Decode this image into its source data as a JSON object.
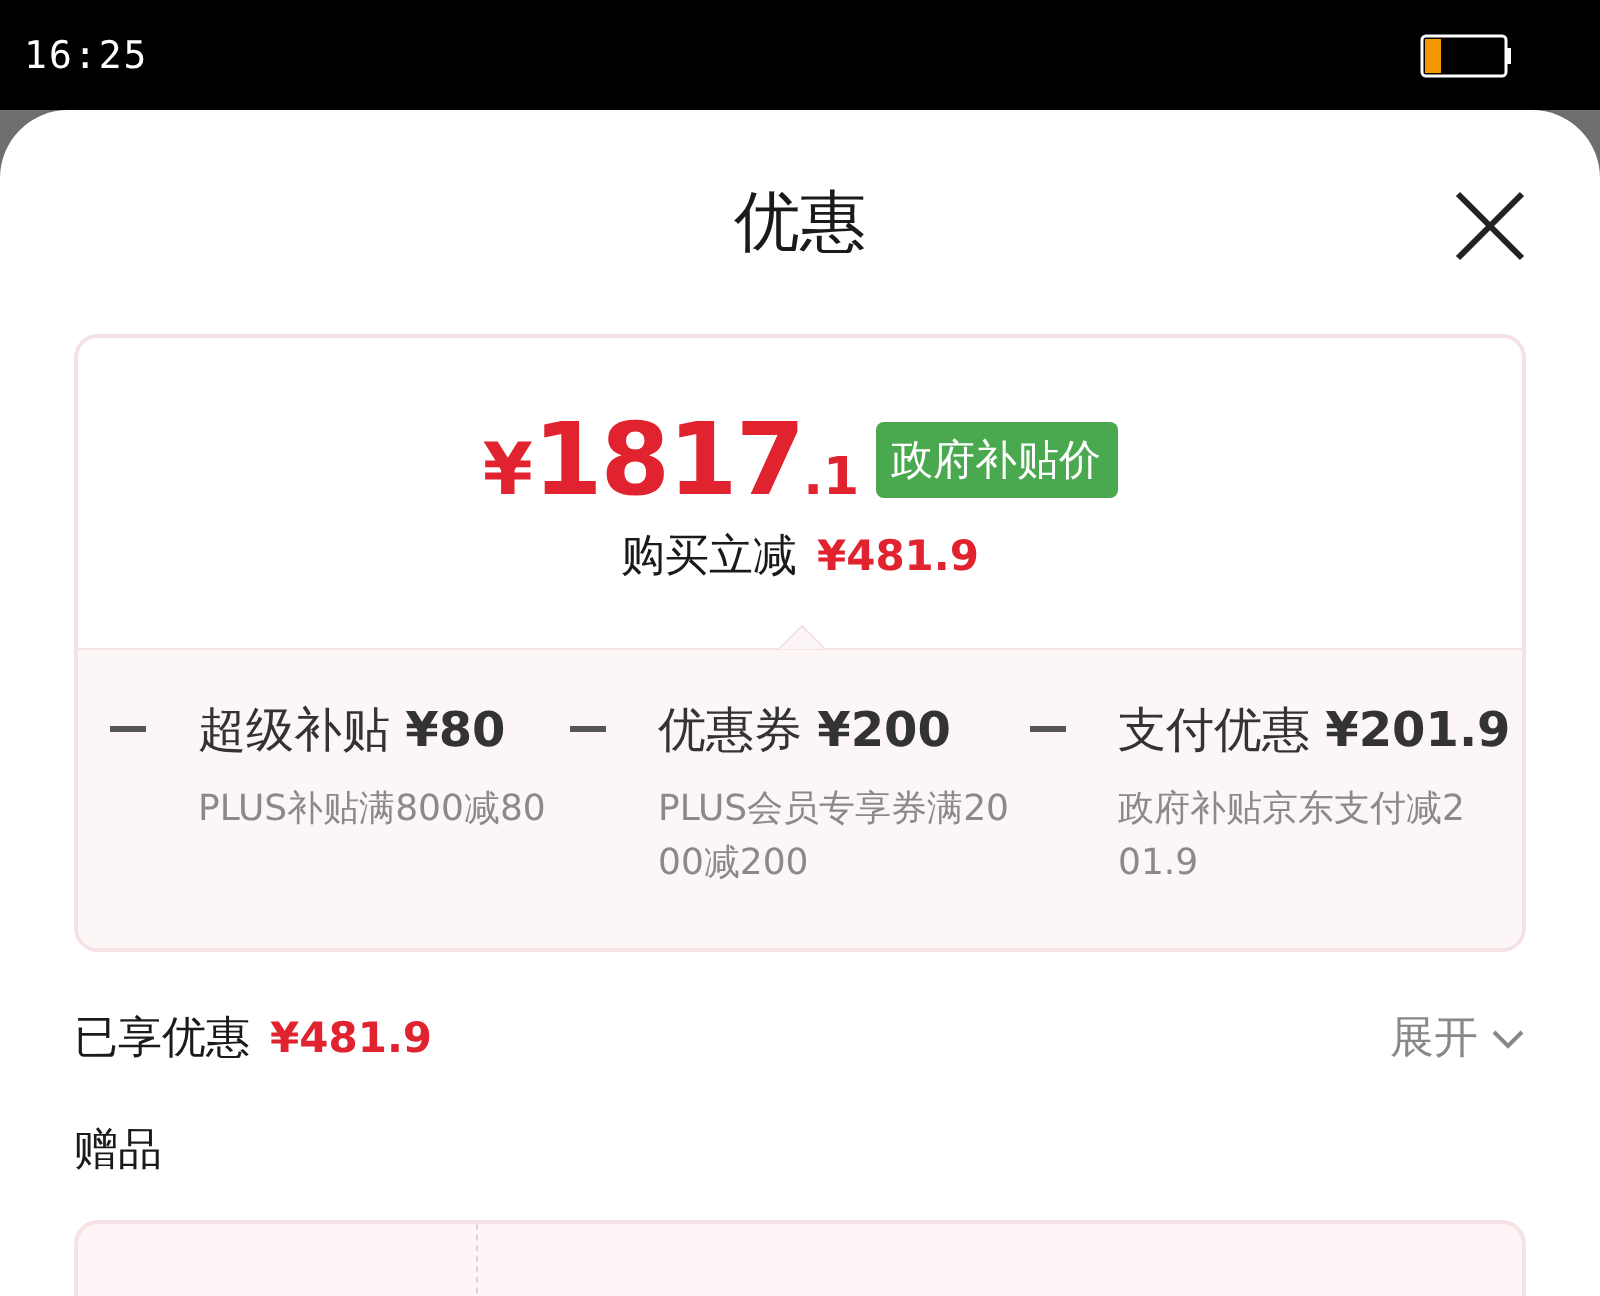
{
  "status_bar": {
    "time": "16:25"
  },
  "sheet": {
    "title": "优惠"
  },
  "price": {
    "currency": "¥",
    "integer": "1817",
    "decimal": ".1",
    "badge": "政府补贴价",
    "reduction_label": "购买立减",
    "reduction_amount": "¥481.9"
  },
  "discounts": [
    {
      "title": "超级补贴",
      "amount": "¥80",
      "description": "PLUS补贴满800减80"
    },
    {
      "title": "优惠券",
      "amount": "¥200",
      "description": "PLUS会员专享券满2000减200"
    },
    {
      "title": "支付优惠",
      "amount": "¥201.9",
      "description": "政府补贴京东支付减201.9"
    }
  ],
  "summary": {
    "label": "已享优惠",
    "amount": "¥481.9",
    "expand_label": "展开"
  },
  "gifts": {
    "title": "赠品"
  }
}
